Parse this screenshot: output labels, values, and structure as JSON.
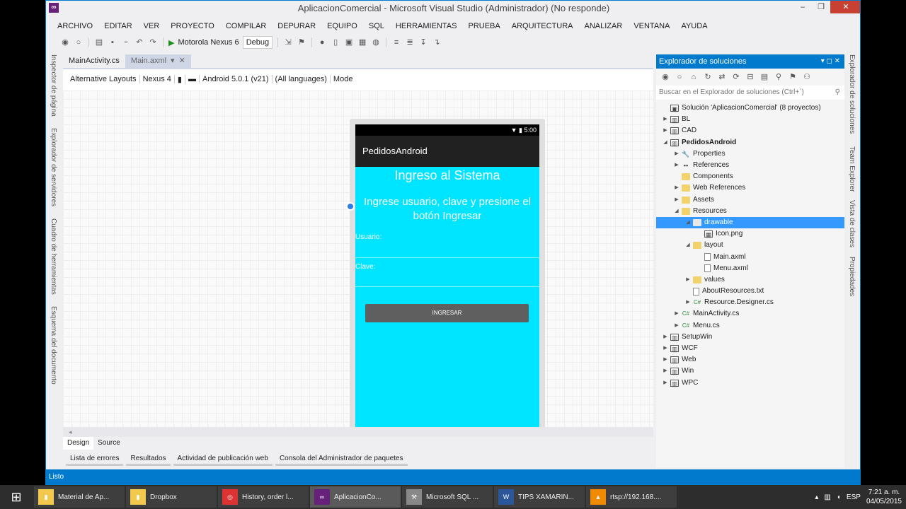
{
  "window": {
    "title": "AplicacionComercial - Microsoft Visual Studio (Administrador) (No responde)",
    "controls": [
      "–",
      "❐",
      "✕"
    ]
  },
  "menu": [
    "ARCHIVO",
    "EDITAR",
    "VER",
    "PROYECTO",
    "COMPILAR",
    "DEPURAR",
    "EQUIPO",
    "SQL",
    "HERRAMIENTAS",
    "PRUEBA",
    "ARQUITECTURA",
    "ANALIZAR",
    "VENTANA",
    "AYUDA"
  ],
  "toolbar": {
    "run_target": "Motorola Nexus 6",
    "config": "Debug"
  },
  "left_rail": [
    "Inspector de página",
    "Explorador de servidores",
    "Cuadro de herramientas",
    "Esquema del documento"
  ],
  "right_rail": [
    "Explorador de soluciones",
    "Team Explorer",
    "Vista de clases",
    "Propiedades"
  ],
  "doc_tabs": [
    {
      "label": "MainActivity.cs",
      "active": false
    },
    {
      "label": "Main.axml",
      "active": true
    }
  ],
  "designer_toolbar": [
    "Alternative Layouts",
    "Nexus 4",
    "Android 5.0.1 (v21)",
    "(All languages)",
    "Mode"
  ],
  "phone": {
    "status_time": "5:00",
    "app_title": "PedidosAndroid",
    "heading": "Ingreso al Sistema",
    "instructions": "Ingrese usuario, clave y presione el botón Ingresar",
    "user_label": "Usuario:",
    "password_label": "Clave:",
    "button_label": "INGRESAR",
    "background_color": "#00e5ff"
  },
  "bottom_tabs": [
    {
      "label": "Design",
      "active": true
    },
    {
      "label": "Source",
      "active": false
    }
  ],
  "output_tabs": [
    "Lista de errores",
    "Resultados",
    "Actividad de publicación web",
    "Consola del Administrador de paquetes"
  ],
  "status_text": "Listo",
  "solution_explorer": {
    "title": "Explorador de soluciones",
    "search_placeholder": "Buscar en el Explorador de soluciones (Ctrl+`)",
    "items": [
      {
        "label": "Solución 'AplicacionComercial' (8 proyectos)",
        "level": 0,
        "toggle": "",
        "icon": "solution-icon",
        "selected": false
      },
      {
        "label": "BL",
        "level": 0,
        "toggle": "▶",
        "icon": "project-icon",
        "selected": false
      },
      {
        "label": "CAD",
        "level": 0,
        "toggle": "▶",
        "icon": "project-icon",
        "selected": false
      },
      {
        "label": "PedidosAndroid",
        "level": 0,
        "toggle": "◢",
        "icon": "project-icon",
        "selected": false,
        "bold": true
      },
      {
        "label": "Properties",
        "level": 1,
        "toggle": "▶",
        "icon": "wrench-icon",
        "selected": false
      },
      {
        "label": "References",
        "level": 1,
        "toggle": "▶",
        "icon": "references-icon",
        "selected": false
      },
      {
        "label": "Components",
        "level": 1,
        "toggle": "",
        "icon": "folder-icon",
        "selected": false
      },
      {
        "label": "Web References",
        "level": 1,
        "toggle": "▶",
        "icon": "folder-icon",
        "selected": false
      },
      {
        "label": "Assets",
        "level": 1,
        "toggle": "▶",
        "icon": "folder-icon",
        "selected": false
      },
      {
        "label": "Resources",
        "level": 1,
        "toggle": "◢",
        "icon": "folder-icon",
        "selected": false
      },
      {
        "label": "drawable",
        "level": 2,
        "toggle": "◢",
        "icon": "folder-icon",
        "selected": true
      },
      {
        "label": "Icon.png",
        "level": 3,
        "toggle": "",
        "icon": "image-file-icon",
        "selected": false
      },
      {
        "label": "layout",
        "level": 2,
        "toggle": "◢",
        "icon": "folder-icon",
        "selected": false
      },
      {
        "label": "Main.axml",
        "level": 3,
        "toggle": "",
        "icon": "file-icon",
        "selected": false
      },
      {
        "label": "Menu.axml",
        "level": 3,
        "toggle": "",
        "icon": "file-icon",
        "selected": false
      },
      {
        "label": "values",
        "level": 2,
        "toggle": "▶",
        "icon": "folder-icon",
        "selected": false
      },
      {
        "label": "AboutResources.txt",
        "level": 2,
        "toggle": "",
        "icon": "file-icon",
        "selected": false
      },
      {
        "label": "Resource.Designer.cs",
        "level": 2,
        "toggle": "▶",
        "icon": "csharp-file-icon",
        "selected": false
      },
      {
        "label": "MainActivity.cs",
        "level": 1,
        "toggle": "▶",
        "icon": "csharp-file-icon",
        "selected": false
      },
      {
        "label": "Menu.cs",
        "level": 1,
        "toggle": "▶",
        "icon": "csharp-file-icon",
        "selected": false
      },
      {
        "label": "SetupWin",
        "level": 0,
        "toggle": "▶",
        "icon": "project-icon",
        "selected": false
      },
      {
        "label": "WCF",
        "level": 0,
        "toggle": "▶",
        "icon": "project-icon",
        "selected": false
      },
      {
        "label": "Web",
        "level": 0,
        "toggle": "▶",
        "icon": "project-icon",
        "selected": false
      },
      {
        "label": "Win",
        "level": 0,
        "toggle": "▶",
        "icon": "project-icon",
        "selected": false
      },
      {
        "label": "WPC",
        "level": 0,
        "toggle": "▶",
        "icon": "project-icon",
        "selected": false
      }
    ]
  },
  "taskbar": {
    "items": [
      {
        "label": "Material de Ap...",
        "icon": "folder-icon",
        "active": false
      },
      {
        "label": "Dropbox",
        "icon": "folder-icon",
        "active": false
      },
      {
        "label": "History, order l...",
        "icon": "chrome-icon",
        "active": false
      },
      {
        "label": "AplicacionCo...",
        "icon": "visual-studio-icon",
        "active": true
      },
      {
        "label": "Microsoft SQL ...",
        "icon": "sql-server-icon",
        "active": false
      },
      {
        "label": "TIPS XAMARIN...",
        "icon": "word-icon",
        "active": false
      },
      {
        "label": "rtsp://192.168....",
        "icon": "vlc-icon",
        "active": false
      }
    ],
    "language": "ESP",
    "time": "7:21 a. m.",
    "date": "04/05/2015"
  }
}
